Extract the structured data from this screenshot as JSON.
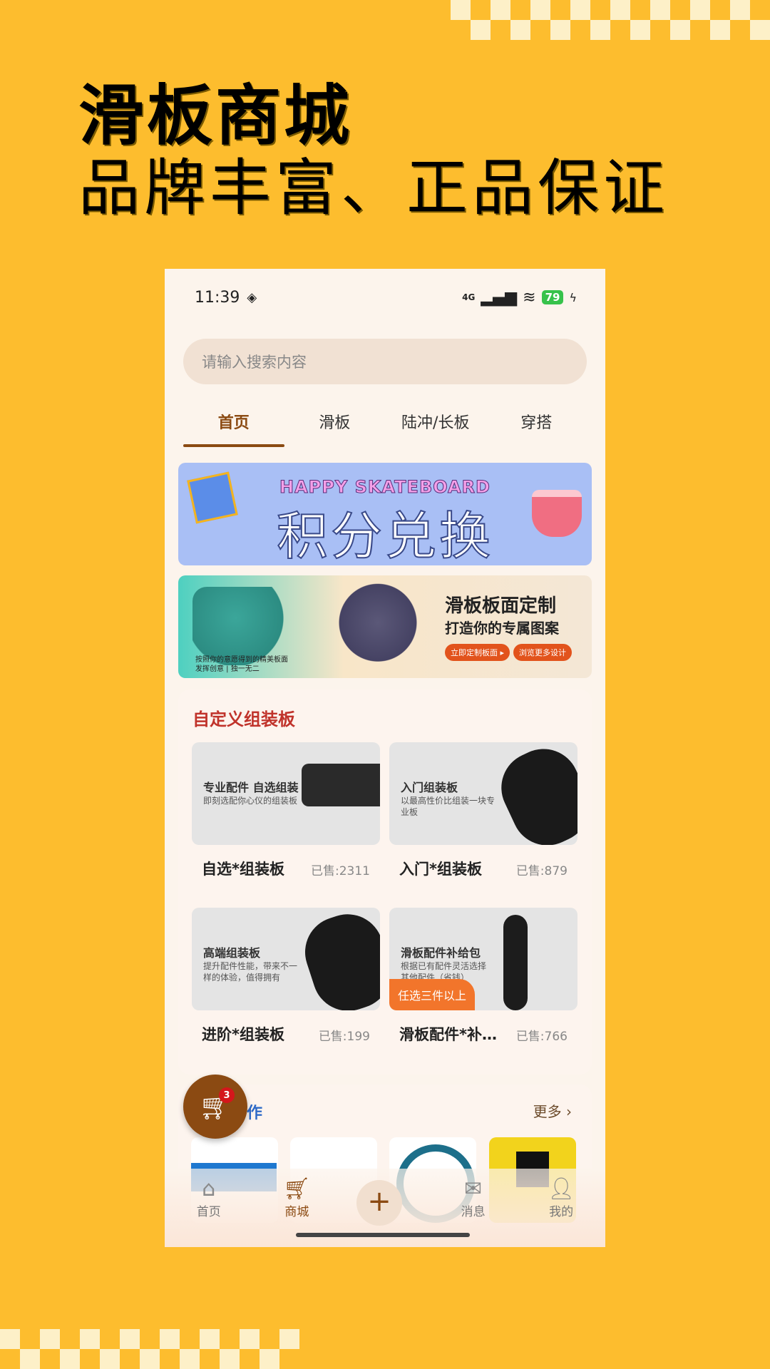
{
  "headline": {
    "title": "滑板商城",
    "subtitle": "品牌丰富、正品保证"
  },
  "status": {
    "time": "11:39",
    "network": "4G",
    "battery": "79"
  },
  "search": {
    "placeholder": "请输入搜索内容"
  },
  "tabs": [
    {
      "label": "首页",
      "active": true
    },
    {
      "label": "滑板",
      "active": false
    },
    {
      "label": "陆冲/长板",
      "active": false
    },
    {
      "label": "穿搭",
      "active": false
    }
  ],
  "banner1": {
    "eyebrow": "HAPPY SKATEBOARD",
    "title": "积分兑换"
  },
  "banner2": {
    "title": "滑板板面定制",
    "subtitle": "打造你的专属图案",
    "btn1": "立即定制板面 ▸",
    "btn2": "浏览更多设计",
    "note": "按照你的意愿得到的精美板面\n发挥创意 | 独一无二"
  },
  "custom_section": {
    "title": "自定义组装板",
    "products": [
      {
        "img_title": "专业配件  自选组装",
        "img_desc": "即刻选配你心仪的组装板",
        "name": "自选*组装板",
        "sold": "已售:2311"
      },
      {
        "img_title": "入门组装板",
        "img_desc": "以最高性价比组装一块专业板",
        "name": "入门*组装板",
        "sold": "已售:879"
      },
      {
        "img_title": "高端组装板",
        "img_desc": "提升配件性能，带来不一样的体验，值得拥有",
        "name": "进阶*组装板",
        "sold": "已售:199"
      },
      {
        "img_title": "滑板配件补给包",
        "img_desc": "根据已有配件灵活选择其他配件（省钱）",
        "name": "滑板配件*补给包",
        "sold": "已售:766",
        "tag": "任选三件以上"
      }
    ]
  },
  "brand_section": {
    "title": "作",
    "more": "更多 ›"
  },
  "cart": {
    "count": "3"
  },
  "bottom_nav": [
    {
      "label": "首页",
      "icon": "home-icon"
    },
    {
      "label": "商城",
      "icon": "cart-icon"
    },
    {
      "label": "",
      "icon": "plus-icon"
    },
    {
      "label": "消息",
      "icon": "message-icon"
    },
    {
      "label": "我的",
      "icon": "user-icon"
    }
  ]
}
